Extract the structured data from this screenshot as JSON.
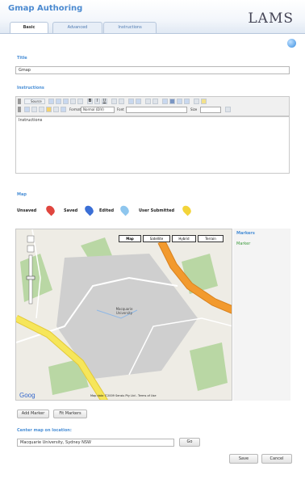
{
  "header": {
    "title": "Gmap Authoring",
    "logo": "LAMS",
    "tabs": [
      {
        "label": "Basic",
        "active": true
      },
      {
        "label": "Advanced",
        "active": false
      },
      {
        "label": "Instructions",
        "active": false
      }
    ]
  },
  "title_section": {
    "label": "Title",
    "value": "Gmap"
  },
  "instructions_section": {
    "label": "Instructions",
    "content": "Instructions",
    "toolbar": {
      "source_label": "Source",
      "format_label": "Format",
      "format_value": "Normal (DIV)",
      "font_label": "Font",
      "size_label": "Size"
    }
  },
  "map_section": {
    "label": "Map",
    "markers": [
      {
        "label": "Unsaved",
        "color": "#e0463f"
      },
      {
        "label": "Saved",
        "color": "#3b6fd6"
      },
      {
        "label": "Edited",
        "color": "#8ec6ee"
      },
      {
        "label": "User Submitted",
        "color": "#f3d43a"
      }
    ],
    "map_types": [
      "Map",
      "Satellite",
      "Hybrid",
      "Terrain"
    ],
    "map_labels": {
      "place": "Macquarie University",
      "footer_attribution": "Map data ©2009 Sensis Pty Ltd - Terms of Use"
    },
    "side_panel": {
      "markers_label": "Markers",
      "marker_items": [
        "Marker"
      ]
    },
    "buttons": {
      "add_marker": "Add Marker",
      "fit_markers": "Fit Markers"
    }
  },
  "center_map": {
    "label": "Center map on location:",
    "value": "Macquarie University, Sydney NSW",
    "go_label": "Go"
  },
  "footer_buttons": {
    "save": "Save",
    "cancel": "Cancel"
  },
  "colors": {
    "accent": "#4a8fd6",
    "road_orange": "#f29a2e",
    "road_yellow": "#f6e65a",
    "park_green": "#b9d7a4",
    "campus_gray": "#cfcfcf"
  }
}
